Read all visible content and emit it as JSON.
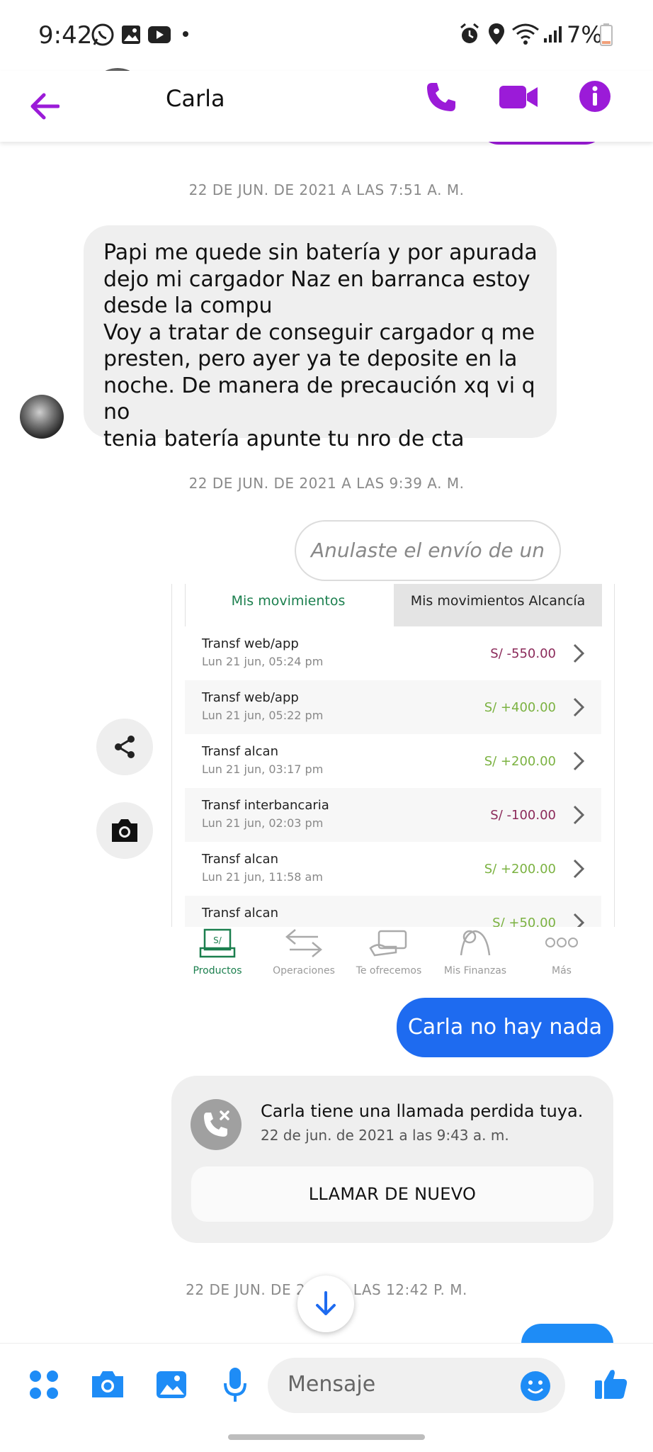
{
  "status_bar": {
    "time": "9:42",
    "battery": "7%"
  },
  "header": {
    "contact_name": "Carla",
    "accent_color": "#9b1bd8",
    "icons": [
      "back-arrow-icon",
      "phone-icon",
      "video-camera-icon",
      "info-icon"
    ]
  },
  "thread": {
    "date_1": "22 DE JUN. DE 2021 A LAS 7:51 A. M.",
    "incoming_message": "Papi me quede sin batería y por apurada\ndejo mi cargador Naz en barranca estoy\ndesde la compu\nVoy a tratar de conseguir cargador q me\npresten, pero ayer ya te deposite en la\nnoche. De manera de precaución xq vi q no\ntenia batería apunte tu nro de cta",
    "date_2": "22 DE JUN. DE 2021 A LAS 9:39 A. M.",
    "unsent_notice": "Anulaste el envío de un mensaje",
    "date_3": "22 DE JUN. DE 2021 A LAS 12:42 P. M."
  },
  "bank_screenshot": {
    "tab_active": "Mis movimientos",
    "tab_inactive": "Mis movimientos Alcancía",
    "rows": [
      {
        "title": "Transf web/app",
        "date": "Lun 21 jun, 05:24 pm",
        "amount": "S/ -550.00",
        "sign": "neg"
      },
      {
        "title": "Transf web/app",
        "date": "Lun 21 jun, 05:22 pm",
        "amount": "S/ +400.00",
        "sign": "pos"
      },
      {
        "title": "Transf alcan",
        "date": "Lun 21 jun, 03:17 pm",
        "amount": "S/ +200.00",
        "sign": "pos"
      },
      {
        "title": "Transf interbancaria",
        "date": "Lun 21 jun, 02:03 pm",
        "amount": "S/ -100.00",
        "sign": "neg"
      },
      {
        "title": "Transf alcan",
        "date": "Lun 21 jun, 11:58 am",
        "amount": "S/ +200.00",
        "sign": "pos"
      },
      {
        "title": "Transf alcan",
        "date": "",
        "amount": "S/ +50.00",
        "sign": "pos"
      }
    ],
    "nav": [
      "Productos",
      "Operaciones",
      "Te ofrecemos",
      "Mis Finanzas",
      "Más"
    ],
    "negative_color": "#8b2a5a",
    "positive_color": "#7bb241",
    "brand_green": "#1b7f4e"
  },
  "sent_message": "Carla no hay nada",
  "missed_call": {
    "text": "Carla tiene una llamada perdida tuya.",
    "timestamp": "22 de jun. de 2021 a las 9:43 a. m.",
    "button": "LLAMAR DE NUEVO"
  },
  "composer": {
    "placeholder": "Mensaje",
    "icons": [
      "menu-dots-icon",
      "camera-icon",
      "gallery-icon",
      "microphone-icon",
      "emoji-icon",
      "like-icon"
    ]
  }
}
